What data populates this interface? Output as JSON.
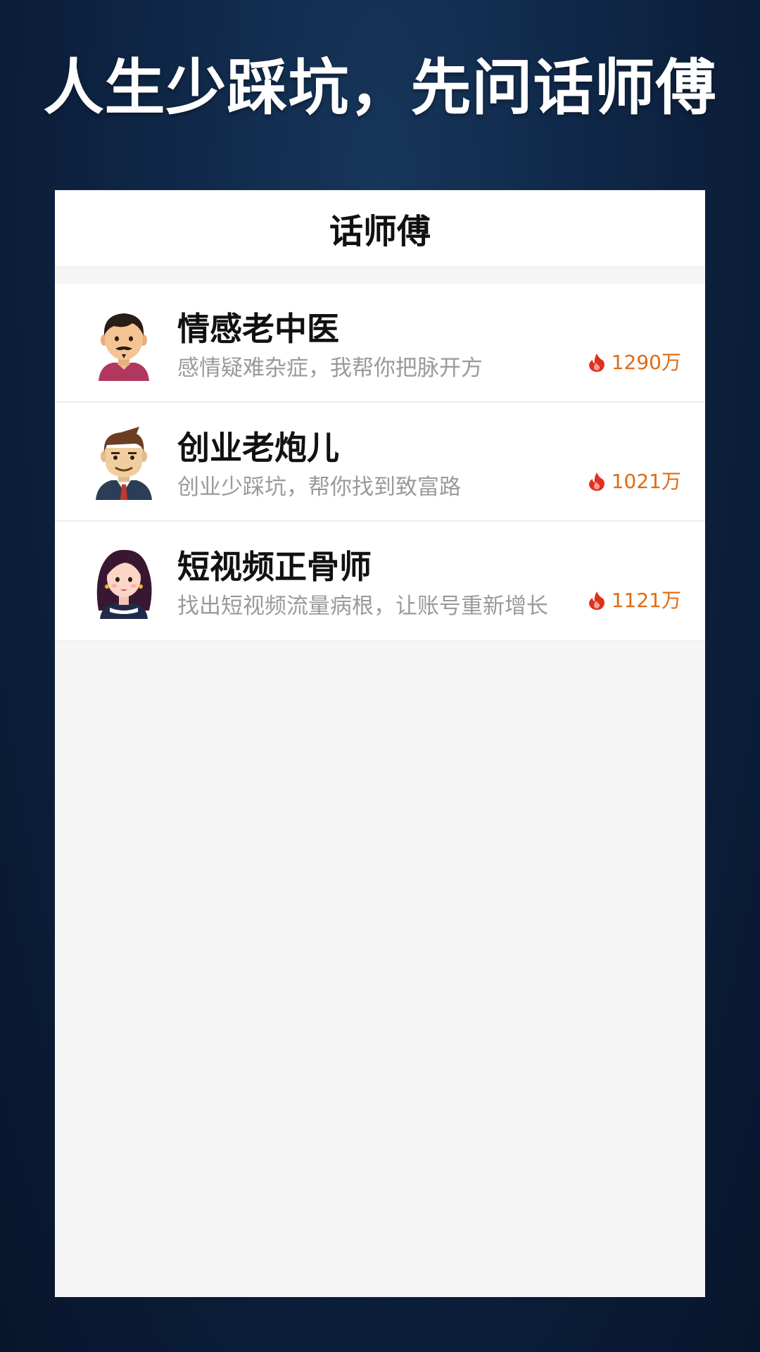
{
  "headline": "人生少踩坑，先问话师傅",
  "app": {
    "title": "话师傅"
  },
  "masters": [
    {
      "name": "情感老中医",
      "desc": "感情疑难杂症，我帮你把脉开方",
      "heat": "1290万",
      "avatar_icon": "man-mustache-avatar-icon"
    },
    {
      "name": "创业老炮儿",
      "desc": "创业少踩坑，帮你找到致富路",
      "heat": "1021万",
      "avatar_icon": "man-suit-avatar-icon"
    },
    {
      "name": "短视频正骨师",
      "desc": "找出短视频流量病根，让账号重新增长",
      "heat": "1121万",
      "avatar_icon": "woman-avatar-icon"
    }
  ],
  "colors": {
    "background": "#0f2746",
    "heat": "#e06a10",
    "fire_icon": "#e0301e",
    "desc": "#9a9a9a"
  },
  "heat_icon": "fire-icon"
}
